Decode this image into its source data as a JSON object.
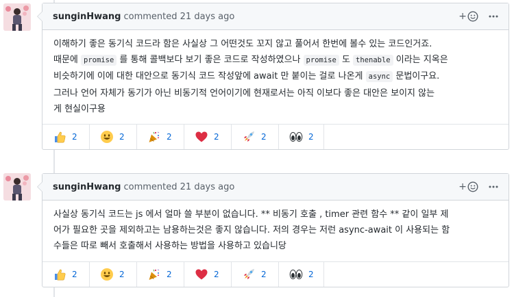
{
  "comments": [
    {
      "author": "sunginHwang",
      "action": "commented 21 days ago",
      "add_reaction": "+",
      "body": [
        [
          {
            "t": "이해하기 좋은 동기식 코드라 함은 사실상 그 어떤것도 꼬지 않고 풀어서 한번에 볼수 있는 코드인거죠."
          }
        ],
        [
          {
            "t": "때문에 "
          },
          {
            "c": "promise"
          },
          {
            "t": " 를 통해 콜백보다 보기 좋은 코드로 작성하였으나 "
          },
          {
            "c": "promise"
          },
          {
            "t": " 도 "
          },
          {
            "c": "thenable"
          },
          {
            "t": " 이라는 지옥은"
          }
        ],
        [
          {
            "t": "비슷하기에 이에 대한 대안으로 동기식 코드 작성앞에 await 만 붙이는 걸로 나온게 "
          },
          {
            "c": "async"
          },
          {
            "t": " 문법이구요."
          }
        ],
        [
          {
            "t": "그러나 언어 자체가 동기가 아닌 비동기적 언어이기에 현재로서는 아직 이보다 좋은 대안은 보이지 않는"
          }
        ],
        [
          {
            "t": "게 현실이구용"
          }
        ]
      ],
      "reactions": [
        {
          "icon": "thumbs-up-icon",
          "count": "2"
        },
        {
          "icon": "smile-icon",
          "count": "2"
        },
        {
          "icon": "tada-icon",
          "count": "2"
        },
        {
          "icon": "heart-icon",
          "count": "2"
        },
        {
          "icon": "rocket-icon",
          "count": "2"
        },
        {
          "icon": "eyes-icon",
          "count": "2"
        }
      ]
    },
    {
      "author": "sunginHwang",
      "action": "commented 21 days ago",
      "add_reaction": "+",
      "body": [
        [
          {
            "t": "사실상 동기식 코드는 js 에서 얼마 쓸 부분이 없습니다. ** 비동기 호출 , timer 관련 함수 ** 같이 일부 제"
          }
        ],
        [
          {
            "t": "어가 필요한 곳을 제외하고는 남용하는것은 좋지 않습니다. 저의 경우는 저런 async-await 이 사용되는 함"
          }
        ],
        [
          {
            "t": "수들은 따로 빼서 호출해서 사용하는 방법을 사용하고 있습니당"
          }
        ]
      ],
      "reactions": [
        {
          "icon": "thumbs-up-icon",
          "count": "2"
        },
        {
          "icon": "smile-icon",
          "count": "2"
        },
        {
          "icon": "tada-icon",
          "count": "2"
        },
        {
          "icon": "heart-icon",
          "count": "2"
        },
        {
          "icon": "rocket-icon",
          "count": "2"
        },
        {
          "icon": "eyes-icon",
          "count": "2"
        }
      ]
    }
  ]
}
